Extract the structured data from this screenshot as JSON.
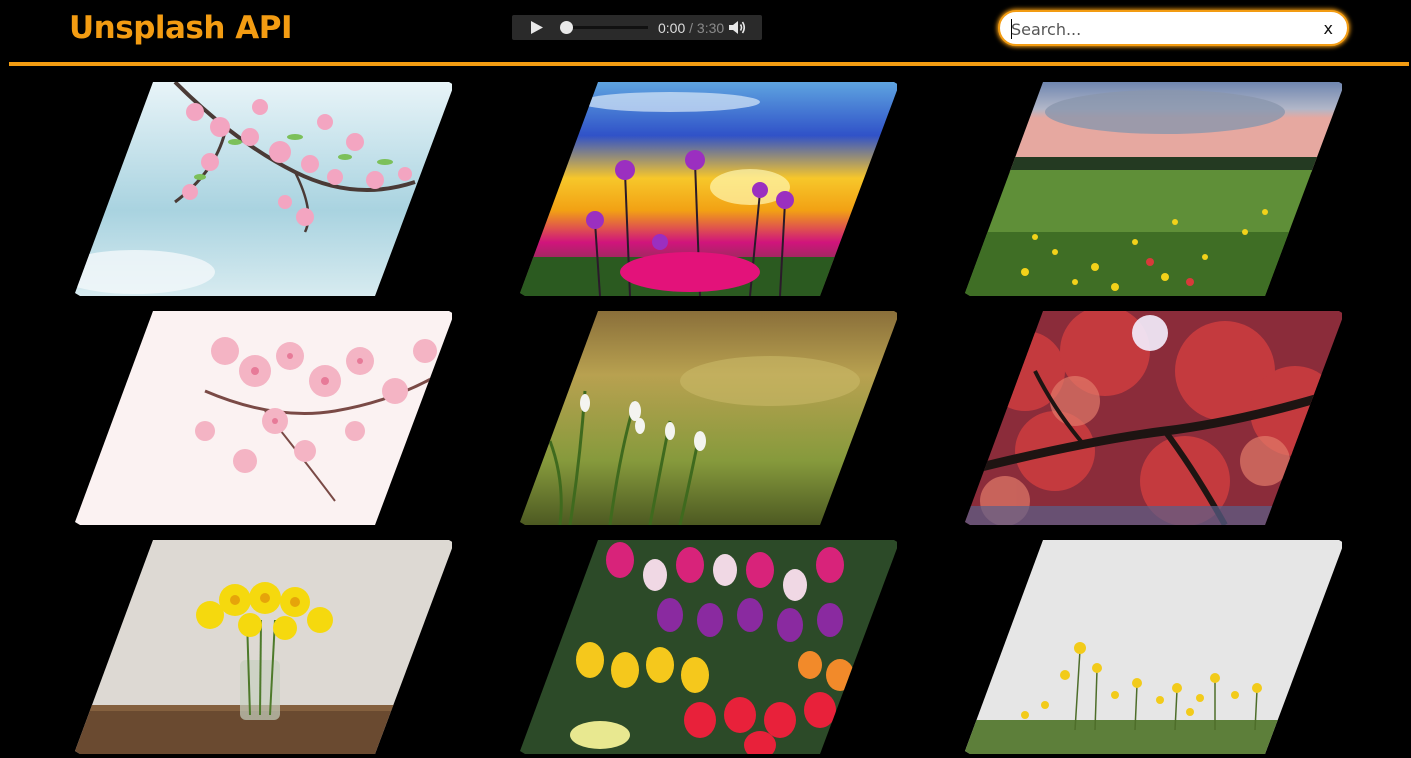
{
  "header": {
    "title": "Unsplash API",
    "accent_color": "#f39c12"
  },
  "audio_player": {
    "play_icon": "play-icon",
    "current_time": "0:00",
    "separator": " / ",
    "duration": "3:30",
    "volume_icon": "volume-icon",
    "progress": 0
  },
  "search": {
    "placeholder": "Search...",
    "value": "",
    "clear_label": "x"
  },
  "gallery": {
    "images": [
      {
        "subject": "pink cherry blossom branch against pale blue sky"
      },
      {
        "subject": "purple wildflowers silhouetted at sunset"
      },
      {
        "subject": "wildflower meadow with yellow blooms under cloudy sky"
      },
      {
        "subject": "close-up of pink cherry blossoms on white"
      },
      {
        "subject": "white snowdrops in soft green grass"
      },
      {
        "subject": "red autumn tree canopy with sun flare"
      },
      {
        "subject": "yellow daffodils in a glass jar on wooden table"
      },
      {
        "subject": "colorful tulips at a flower market"
      },
      {
        "subject": "yellow daisies against white sky"
      }
    ]
  }
}
